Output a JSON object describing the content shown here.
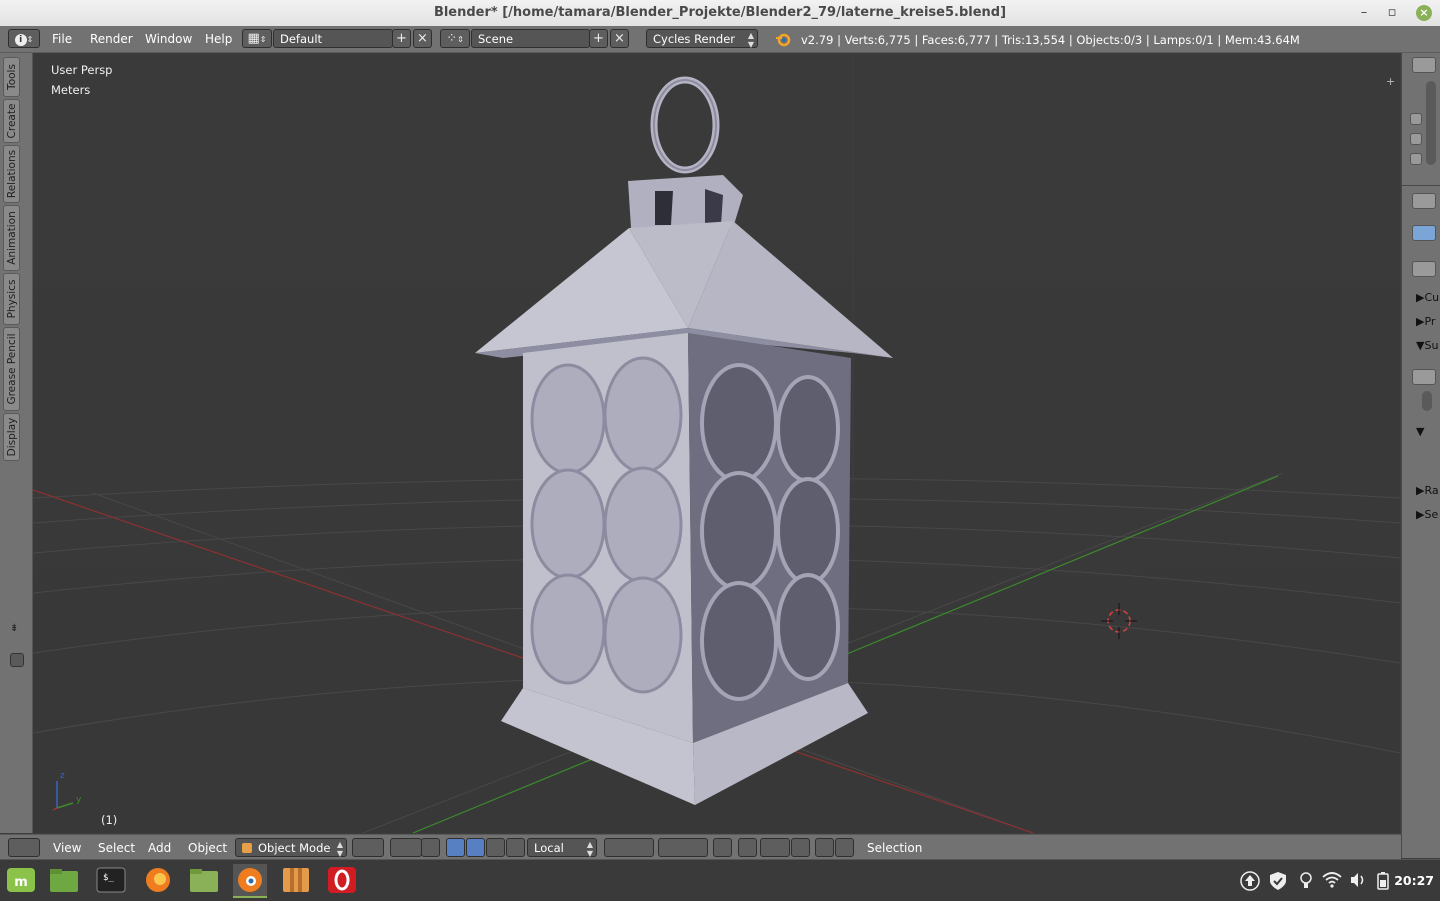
{
  "window": {
    "title": "Blender* [/home/tamara/Blender_Projekte/Blender2_79/laterne_kreise5.blend]",
    "minimize_glyph": "–",
    "maximize_glyph": "▫",
    "close_glyph": "×"
  },
  "info_header": {
    "menus": [
      "File",
      "Render",
      "Window",
      "Help"
    ],
    "screen_layout": "Default",
    "scene": "Scene",
    "render_engine": "Cycles Render",
    "stats": "v2.79 | Verts:6,775 | Faces:6,777 | Tris:13,554 | Objects:0/3 | Lamps:0/1 | Mem:43.64M"
  },
  "tool_tabs": [
    "Tools",
    "Create",
    "Relations",
    "Animation",
    "Physics",
    "Grease Pencil",
    "Display"
  ],
  "viewport": {
    "view_name": "User Persp",
    "units": "Meters",
    "frame": "(1)",
    "axis_z": "z",
    "axis_y": "y"
  },
  "right_panel": {
    "items": [
      "Cu",
      "Pr",
      "Su",
      "Ra",
      "Se"
    ]
  },
  "view3d_header": {
    "menus": [
      "View",
      "Select",
      "Add",
      "Object"
    ],
    "mode": "Object Mode",
    "pivot": "Local",
    "selection_label": "Selection"
  },
  "taskbar": {
    "apps": [
      "mint-menu-icon",
      "files-icon",
      "terminal-icon",
      "firefox-icon",
      "folder-icon",
      "blender-icon",
      "archive-icon",
      "opera-icon"
    ],
    "clock": "20:27"
  },
  "colors": {
    "viewport_bg": "#393939",
    "panel_bg": "#727272",
    "x_axis": "#a03030",
    "y_axis": "#3c8a2c",
    "mesh": "#b8b8c6"
  }
}
